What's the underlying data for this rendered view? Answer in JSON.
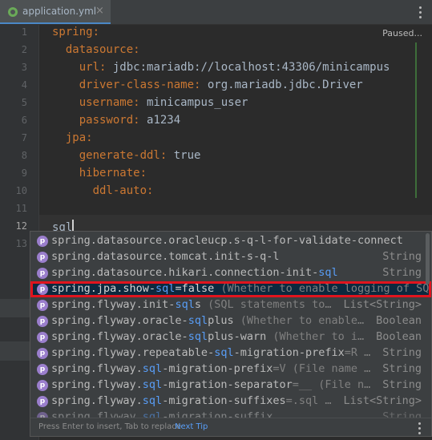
{
  "tab": {
    "title": "application.yml",
    "close": "×"
  },
  "editor": {
    "status": "Paused...",
    "line_numbers": [
      "1",
      "2",
      "3",
      "4",
      "5",
      "6",
      "7",
      "8",
      "9",
      "10",
      "11",
      "12",
      "13"
    ],
    "lines": [
      {
        "key": "spring",
        "sep": ":",
        "value": ""
      },
      {
        "key": "  datasource",
        "sep": ":",
        "value": ""
      },
      {
        "key": "    url",
        "sep": ": ",
        "value": "jdbc:mariadb://localhost:43306/minicampus"
      },
      {
        "key": "    driver-class-name",
        "sep": ": ",
        "value": "org.mariadb.jdbc.Driver"
      },
      {
        "key": "    username",
        "sep": ": ",
        "value": "minicampus_user"
      },
      {
        "key": "    password",
        "sep": ": ",
        "value": "a1234"
      },
      {
        "key": "  jpa",
        "sep": ":",
        "value": ""
      },
      {
        "key": "    generate-ddl",
        "sep": ": ",
        "value": "true"
      },
      {
        "key": "    hibernate",
        "sep": ":",
        "value": ""
      },
      {
        "key": "      ddl-auto",
        "sep": ":",
        "value": ""
      },
      {
        "key": "",
        "sep": "",
        "value": ""
      },
      {
        "key": "",
        "sep": "",
        "value": "sql"
      }
    ]
  },
  "completion": {
    "items": [
      {
        "a": "spring.datasource.oracleucp.s-q-l-for-validate-connecti…",
        "m": "",
        "b": "",
        "d": "",
        "type": ""
      },
      {
        "a": "spring.datasource.tomcat.init-s-q-l",
        "m": "",
        "b": "",
        "d": "",
        "type": "String"
      },
      {
        "a": "spring.datasource.hikari.connection-init-",
        "m": "sql",
        "b": "",
        "d": "",
        "type": "String"
      },
      {
        "a": "spring.jpa.show-",
        "m": "sql",
        "b": "=false",
        "d": " (Whether to enable logging of SQL",
        "type": ""
      },
      {
        "a": "spring.flyway.init-",
        "m": "sql",
        "b": "s",
        "d": " (SQL statements to…",
        "type": "List<String>"
      },
      {
        "a": "spring.flyway.oracle-",
        "m": "sql",
        "b": "plus",
        "d": " (Whether to enable…",
        "type": "Boolean"
      },
      {
        "a": "spring.flyway.oracle-",
        "m": "sql",
        "b": "plus-warn",
        "d": " (Whether to i…",
        "type": "Boolean"
      },
      {
        "a": "spring.flyway.repeatable-",
        "m": "sql",
        "b": "-migration-prefix",
        "d": "=R …",
        "type": "String"
      },
      {
        "a": "spring.flyway.",
        "m": "sql",
        "b": "-migration-prefix",
        "d": "=V (File name …",
        "type": "String"
      },
      {
        "a": "spring.flyway.",
        "m": "sql",
        "b": "-migration-separator",
        "d": "=__ (File n…",
        "type": "String"
      },
      {
        "a": "spring.flyway.",
        "m": "sql",
        "b": "-migration-suffixes",
        "d": "=.sql …",
        "type": "List<String>"
      },
      {
        "a": "spring.flyway.",
        "m": "sql",
        "b": "-migration-suffix",
        "d": "",
        "type": "String"
      }
    ],
    "icon_letter": "p",
    "footer_hint": "Press Enter to insert, Tab to replace",
    "footer_link": "Next Tip"
  }
}
